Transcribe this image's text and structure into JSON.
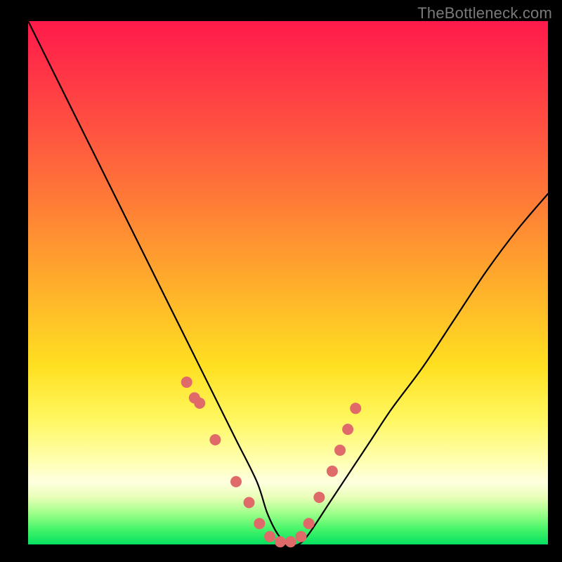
{
  "watermark": "TheBottleneck.com",
  "colors": {
    "frame": "#000000",
    "marker": "#e06a6a",
    "curve": "#000000",
    "gradient_stops": [
      "#ff1a4b",
      "#ff2f47",
      "#ff5640",
      "#ff8035",
      "#ffb32a",
      "#ffe021",
      "#fff75f",
      "#ffffb0",
      "#ffffe0",
      "#e9ffb8",
      "#9fff8a",
      "#48f56a",
      "#06e060"
    ]
  },
  "chart_data": {
    "type": "line",
    "title": "",
    "xlabel": "",
    "ylabel": "",
    "xlim": [
      0,
      100
    ],
    "ylim": [
      0,
      100
    ],
    "annotations": [],
    "series": [
      {
        "name": "bottleneck-curve",
        "x": [
          0,
          4,
          8,
          12,
          16,
          20,
          24,
          28,
          32,
          36,
          40,
          44,
          46,
          48,
          50,
          52,
          54,
          58,
          62,
          66,
          70,
          76,
          82,
          88,
          94,
          100
        ],
        "y": [
          100,
          92,
          84,
          76,
          68,
          60,
          52,
          44,
          36,
          28,
          20,
          12,
          6,
          2,
          0,
          0,
          2,
          8,
          14,
          20,
          26,
          34,
          43,
          52,
          60,
          67
        ]
      }
    ],
    "markers": {
      "name": "highlight-dots",
      "x": [
        30.5,
        32.0,
        33.0,
        36.0,
        40.0,
        42.5,
        44.5,
        46.5,
        48.5,
        50.5,
        52.5,
        54.0,
        56.0,
        58.5,
        60.0,
        61.5,
        63.0
      ],
      "y": [
        31.0,
        28.0,
        27.0,
        20.0,
        12.0,
        8.0,
        4.0,
        1.5,
        0.5,
        0.5,
        1.5,
        4.0,
        9.0,
        14.0,
        18.0,
        22.0,
        26.0
      ],
      "r": 8
    },
    "background_gradient": {
      "direction": "vertical",
      "meaning": "color encodes y-value proximity to optimum (green near 0, red near 100)"
    }
  }
}
